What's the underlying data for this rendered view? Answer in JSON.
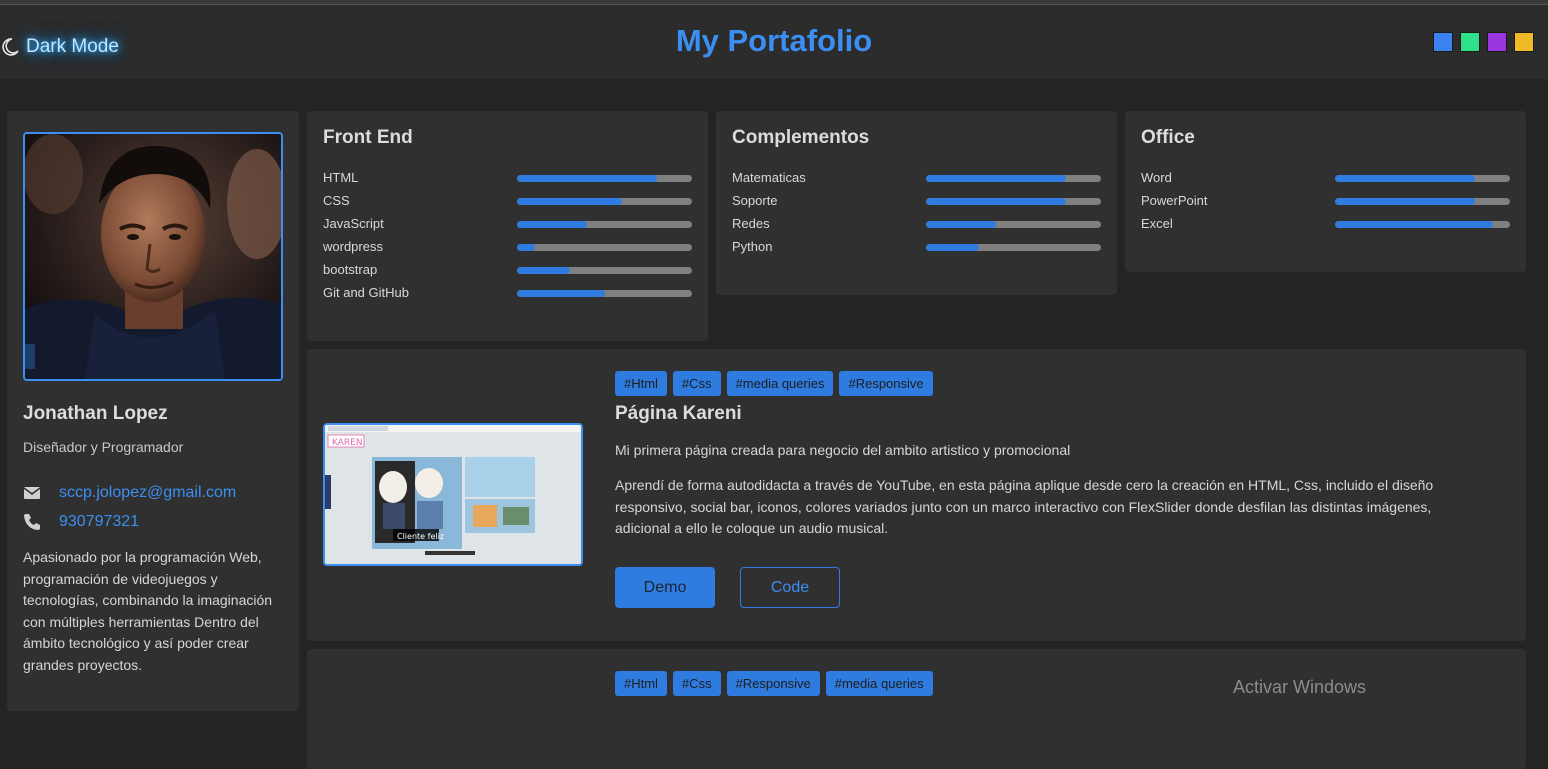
{
  "header": {
    "dark_mode_label": "Dark Mode",
    "title": "My Portafolio",
    "theme_colors": [
      "#3b82f0",
      "#2ee08a",
      "#9a35e0",
      "#efb928"
    ]
  },
  "profile": {
    "name": "Jonathan Lopez",
    "role": "Diseñador y Programador",
    "email": "sccp.jolopez@gmail.com",
    "phone": "930797321",
    "bio": "Apasionado por la programación Web, programación de videojuegos y tecnologías, combinando la imaginación con múltiples herramientas Dentro del ámbito tecnológico y así poder crear grandes proyectos."
  },
  "skills": [
    {
      "title": "Front End",
      "items": [
        {
          "name": "HTML",
          "level": 0.8
        },
        {
          "name": "CSS",
          "level": 0.6
        },
        {
          "name": "JavaScript",
          "level": 0.4
        },
        {
          "name": "wordpress",
          "level": 0.1
        },
        {
          "name": "bootstrap",
          "level": 0.3
        },
        {
          "name": "Git and GitHub",
          "level": 0.5
        }
      ]
    },
    {
      "title": "Complementos",
      "items": [
        {
          "name": "Matematicas",
          "level": 0.8
        },
        {
          "name": "Soporte",
          "level": 0.8
        },
        {
          "name": "Redes",
          "level": 0.4
        },
        {
          "name": "Python",
          "level": 0.3
        }
      ]
    },
    {
      "title": "Office",
      "items": [
        {
          "name": "Word",
          "level": 0.8
        },
        {
          "name": "PowerPoint",
          "level": 0.8
        },
        {
          "name": "Excel",
          "level": 0.9
        }
      ]
    }
  ],
  "projects": [
    {
      "tags": [
        "#Html",
        "#Css",
        "#media queries",
        "#Responsive"
      ],
      "title": "Página Kareni",
      "summary": "Mi primera página creada para negocio del ambito artistico y promocional",
      "description": "Aprendí de forma autodidacta a través de YouTube, en esta página aplique desde cero la creación en HTML, Css, incluido el diseño responsivo, social bar, iconos, colores variados junto con un marco interactivo con FlexSlider donde desfilan las distintas imágenes, adicional a ello le coloque un audio musical.",
      "thumb_caption": "Cliente feliz",
      "thumb_logo": "KAREN",
      "demo_label": "Demo",
      "code_label": "Code"
    },
    {
      "tags": [
        "#Html",
        "#Css",
        "#Responsive",
        "#media queries"
      ]
    }
  ],
  "watermark": "Activar Windows"
}
